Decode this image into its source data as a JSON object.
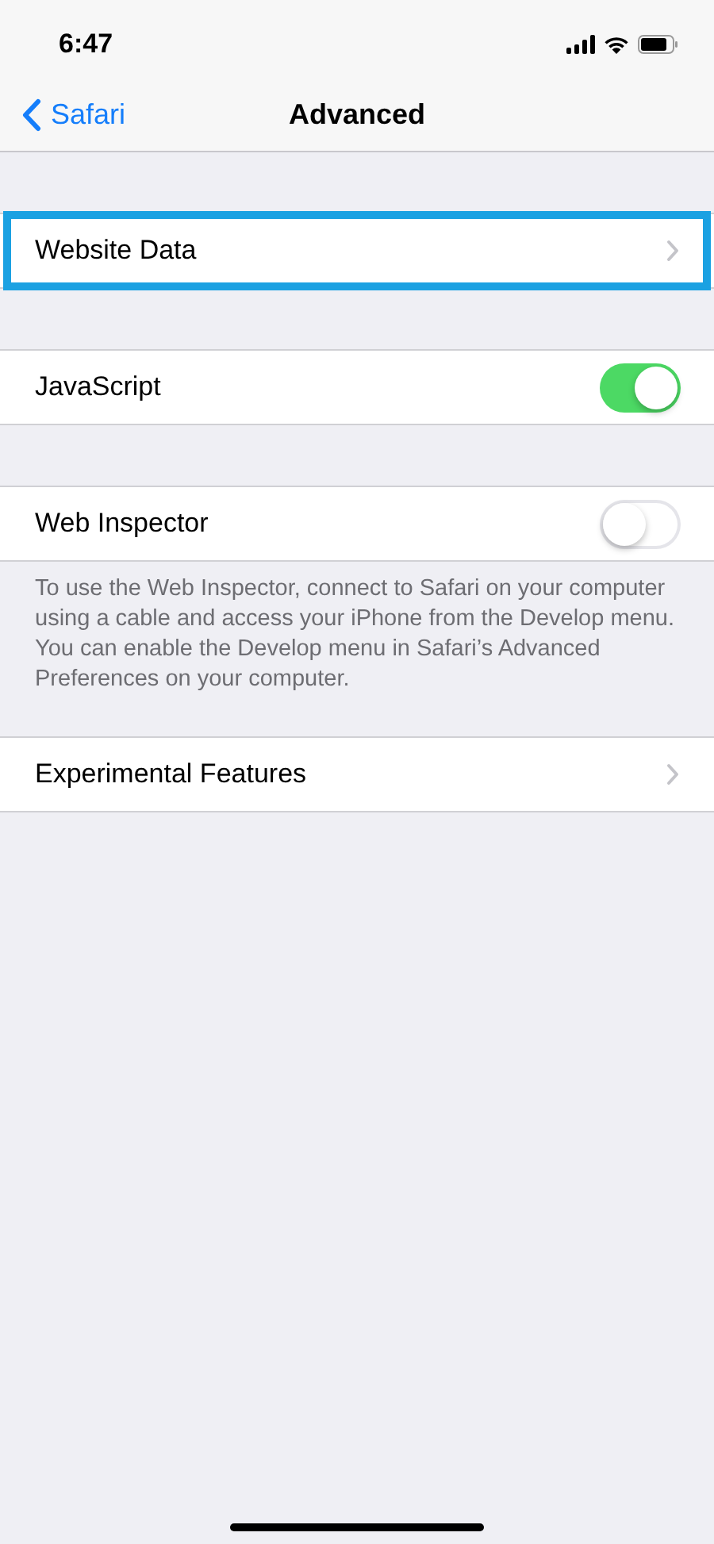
{
  "status_bar": {
    "time": "6:47"
  },
  "nav": {
    "back": "Safari",
    "title": "Advanced"
  },
  "sections": [
    {
      "rows": [
        {
          "kind": "link",
          "label": "Website Data",
          "highlighted": true
        }
      ]
    },
    {
      "rows": [
        {
          "kind": "toggle",
          "label": "JavaScript",
          "on": true
        }
      ]
    },
    {
      "rows": [
        {
          "kind": "toggle",
          "label": "Web Inspector",
          "on": false
        }
      ],
      "footer": "To use the Web Inspector, connect to Safari on your computer using a cable and access your iPhone from the Develop menu. You can enable the Develop menu in Safari’s Advanced Preferences on your computer."
    },
    {
      "rows": [
        {
          "kind": "link",
          "label": "Experimental Features",
          "highlighted": false
        }
      ]
    }
  ]
}
